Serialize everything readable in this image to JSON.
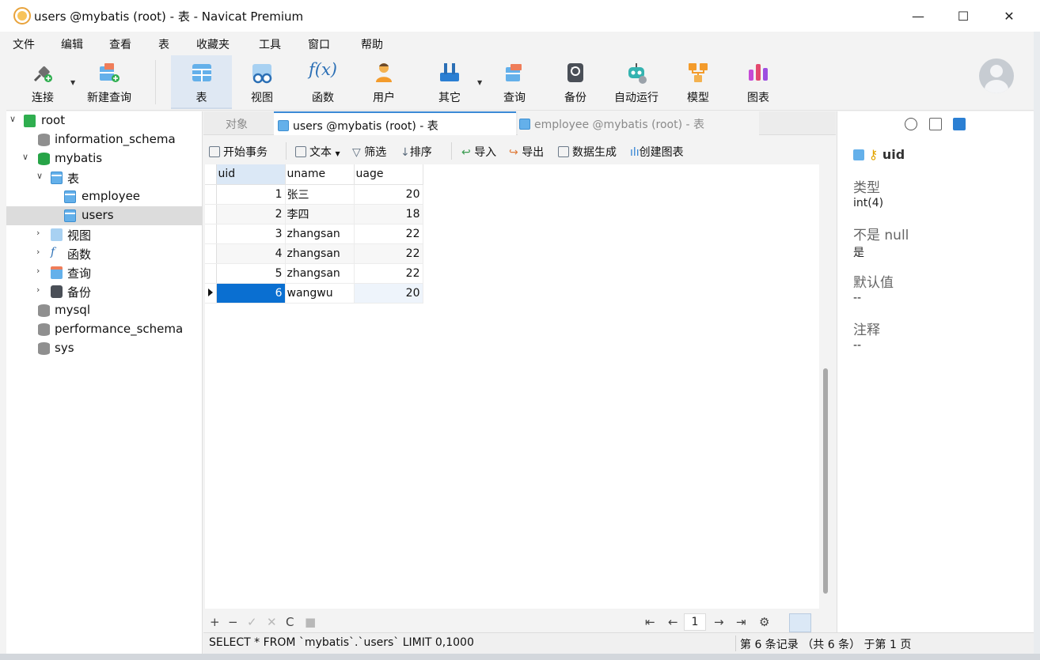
{
  "window": {
    "title": "users @mybatis (root) - 表 - Navicat Premium",
    "controls": [
      "—",
      "☐",
      "✕"
    ]
  },
  "menu": [
    "文件",
    "编辑",
    "查看",
    "表",
    "收藏夹",
    "工具",
    "窗口",
    "帮助"
  ],
  "toolbar": {
    "buttons": [
      {
        "label": "连接",
        "icon": "connect-plug-icon"
      },
      {
        "label": "新建查询",
        "icon": "new-query-icon"
      },
      {
        "label": "表",
        "icon": "table-icon"
      },
      {
        "label": "视图",
        "icon": "view-icon"
      },
      {
        "label": "函数",
        "icon": "function-icon",
        "glyph": "f(x)"
      },
      {
        "label": "用户",
        "icon": "user-icon"
      },
      {
        "label": "其它",
        "icon": "tools-icon"
      },
      {
        "label": "查询",
        "icon": "query-icon"
      },
      {
        "label": "备份",
        "icon": "backup-icon"
      },
      {
        "label": "自动运行",
        "icon": "robot-icon"
      },
      {
        "label": "模型",
        "icon": "model-icon"
      },
      {
        "label": "图表",
        "icon": "chart-icon"
      }
    ],
    "active": "表"
  },
  "tree": {
    "items": [
      {
        "label": "root",
        "icon": "connection-icon"
      },
      {
        "label": "information_schema",
        "icon": "database-icon"
      },
      {
        "label": "mybatis",
        "icon": "database-open-icon"
      },
      {
        "label": "表",
        "icon": "tables-folder-icon"
      },
      {
        "label": "employee",
        "icon": "table-icon"
      },
      {
        "label": "users",
        "icon": "table-icon"
      },
      {
        "label": "视图",
        "icon": "views-folder-icon"
      },
      {
        "label": "函数",
        "icon": "functions-folder-icon"
      },
      {
        "label": "查询",
        "icon": "queries-folder-icon"
      },
      {
        "label": "备份",
        "icon": "backups-folder-icon"
      },
      {
        "label": "mysql",
        "icon": "database-icon"
      },
      {
        "label": "performance_schema",
        "icon": "database-icon"
      },
      {
        "label": "sys",
        "icon": "database-icon"
      }
    ],
    "selected": "users"
  },
  "tabs": {
    "objects": "对象",
    "active": "users @mybatis (root) - 表",
    "inactive": "employee @mybatis (root) - 表"
  },
  "subtoolbar": {
    "begin_tx": "开始事务",
    "text": "文本",
    "filter": "筛选",
    "sort": "排序",
    "import": "导入",
    "export": "导出",
    "data_gen": "数据生成",
    "create_chart": "创建图表"
  },
  "grid": {
    "columns": [
      "uid",
      "uname",
      "uage"
    ],
    "rows": [
      [
        "1",
        "张三",
        "20"
      ],
      [
        "2",
        "李四",
        "18"
      ],
      [
        "3",
        "zhangsan",
        "22"
      ],
      [
        "4",
        "zhangsan",
        "22"
      ],
      [
        "5",
        "zhangsan",
        "22"
      ],
      [
        "6",
        "wangwu",
        "20"
      ]
    ],
    "current_row": 6
  },
  "navbar": {
    "add": "+",
    "remove": "−",
    "apply": "✓",
    "discard": "✕",
    "refresh": "C",
    "stop": "■",
    "first": "⇤",
    "prev": "←",
    "page": "1",
    "next": "→",
    "last": "⇥",
    "settings": "⚙"
  },
  "status": {
    "sql": "SELECT * FROM `mybatis`.`users` LIMIT 0,1000",
    "records": "第 6 条记录 （共 6 条） 于第 1 页"
  },
  "properties": {
    "field_name": "uid",
    "type_label": "类型",
    "type_value": "int(4)",
    "notnull_label": "不是 null",
    "notnull_value": "是",
    "default_label": "默认值",
    "default_value": "--",
    "comment_label": "注释",
    "comment_value": "--"
  },
  "colors": {
    "accent": "#0a6fd1",
    "selected_tree": "#dcdcdc",
    "header_highlight": "#dbe8f6"
  }
}
